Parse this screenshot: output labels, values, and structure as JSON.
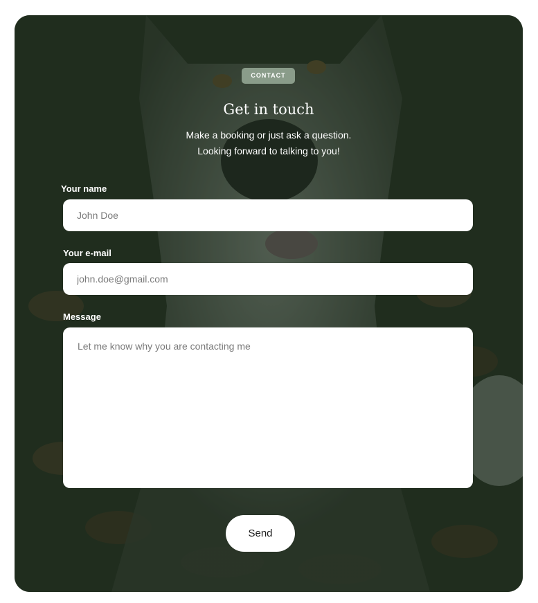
{
  "badge": "CONTACT",
  "heading": "Get in touch",
  "subtitle_line1": "Make a booking or just ask a question.",
  "subtitle_line2": "Looking forward to talking to you!",
  "form": {
    "name": {
      "label": "Your name",
      "placeholder": "John Doe",
      "value": ""
    },
    "email": {
      "label": "Your e-mail",
      "placeholder": "john.doe@gmail.com",
      "value": ""
    },
    "message": {
      "label": "Message",
      "placeholder": "Let me know why you are contacting me",
      "value": ""
    },
    "submit_label": "Send"
  },
  "colors": {
    "overlay": "#1f2b1e",
    "badge_bg": "#8a9c8a",
    "field_bg": "#ffffff",
    "text_on_dark": "#ffffff"
  },
  "background_image": "husky-dog-on-autumn-leaves"
}
